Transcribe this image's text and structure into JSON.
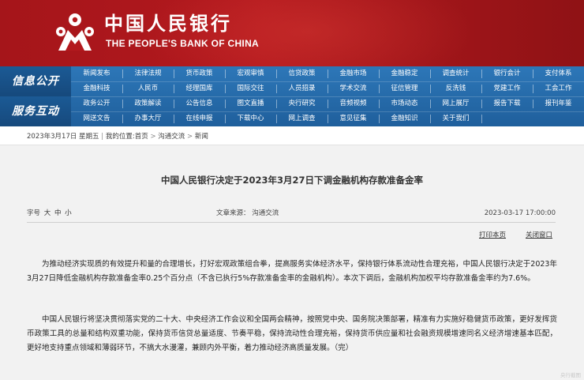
{
  "banner": {
    "title_cn": "中国人民银行",
    "title_en": "THE PEOPLE'S BANK OF CHINA"
  },
  "nav": {
    "sections": [
      "信息公开",
      "服务互动"
    ],
    "rows": [
      [
        "新闻发布",
        "法律法规",
        "货币政策",
        "宏观审慎",
        "信贷政策",
        "金融市场",
        "金融稳定",
        "调查统计",
        "银行会计",
        "支付体系"
      ],
      [
        "金融科技",
        "人民币",
        "经理国库",
        "国际交往",
        "人员招录",
        "学术交流",
        "征信管理",
        "反洗钱",
        "党建工作",
        "工会工作"
      ],
      [
        "政务公开",
        "政策解读",
        "公告信息",
        "图文直播",
        "央行研究",
        "音频视频",
        "市场动态",
        "网上展厅",
        "报告下载",
        "报刊年鉴"
      ],
      [
        "网送文告",
        "办事大厅",
        "在线申报",
        "下载中心",
        "网上调查",
        "意见征集",
        "金融知识",
        "关于我们"
      ]
    ]
  },
  "breadcrumb": {
    "date": "2023年3月17日 星期五",
    "location_label": "我的位置:",
    "items": [
      "首页",
      "沟通交流",
      "新闻"
    ],
    "separator": ">"
  },
  "article": {
    "title": "中国人民银行决定于2023年3月27日下调金融机构存款准备金率",
    "font_size_label": "字号",
    "font_sizes": [
      "大",
      "中",
      "小"
    ],
    "source": "文章来源：  沟通交流",
    "date": "2023-03-17 17:00:00",
    "print_label": "打印本页",
    "close_label": "关闭窗口",
    "paragraphs": [
      "为推动经济实现质的有效提升和量的合理增长，打好宏观政策组合拳，提高服务实体经济水平，保持银行体系流动性合理充裕，中国人民银行决定于2023年3月27日降低金融机构存款准备金率0.25个百分点（不含已执行5%存款准备金率的金融机构）。本次下调后，金融机构加权平均存款准备金率约为7.6%。",
      "中国人民银行将坚决贯彻落实党的二十大、中央经济工作会议和全国两会精神，按照党中央、国务院决策部署，精准有力实施好稳健货币政策，更好发挥货币政策工具的总量和结构双重功能，保持货币信贷总量适度、节奏平稳，保持流动性合理充裕，保持货币供应量和社会融资规模增速同名义经济增速基本匹配，更好地支持重点领域和薄弱环节，不搞大水漫灌，兼顾内外平衡，着力推动经济高质量发展。（完）"
    ]
  },
  "watermark": "央行截图",
  "colors": {
    "banner_red": "#b3191e",
    "nav_blue": "#2d77b8",
    "section_blue": "#1b5a95",
    "content_bg": "#f2f2f2"
  }
}
